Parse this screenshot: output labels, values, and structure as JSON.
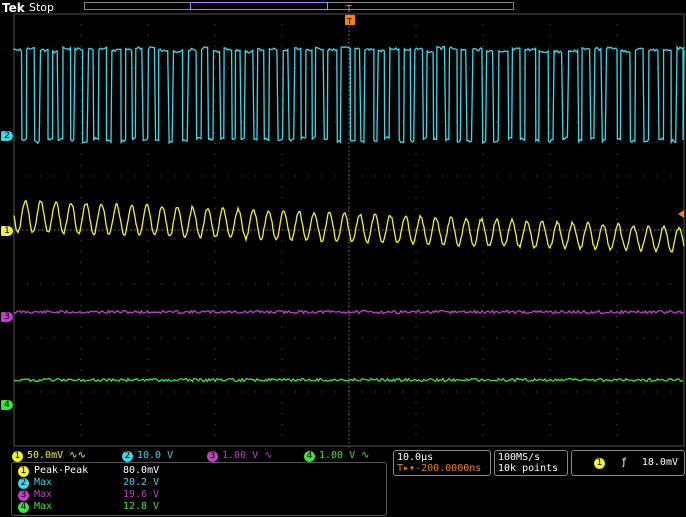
{
  "header": {
    "brand": "Tek",
    "state": "Stop"
  },
  "channels": [
    {
      "id": "1",
      "tag": "1",
      "color": "#f0f040",
      "scale": "50.0mV",
      "coupling_icon": "bandwidth-ac-icon"
    },
    {
      "id": "2",
      "tag": "2",
      "color": "#3fd6e8",
      "scale": "10.0 V",
      "coupling_icon": ""
    },
    {
      "id": "3",
      "tag": "3",
      "color": "#c040c8",
      "scale": "1.00 V",
      "coupling_icon": "bandwidth-icon"
    },
    {
      "id": "4",
      "tag": "4",
      "color": "#40e040",
      "scale": "1.00 V",
      "coupling_icon": "bandwidth-icon"
    }
  ],
  "horizontal": {
    "scale": "10.0µs",
    "trigger_position": "-200.0000ns"
  },
  "acquisition": {
    "sample_rate": "100MS/s",
    "record_length": "10k points"
  },
  "trigger": {
    "source": "1",
    "slope_icon": "rising-edge-icon",
    "level": "18.0mV"
  },
  "measurements": [
    {
      "channel": "1",
      "name": "Peak-Peak",
      "value": "80.0mV"
    },
    {
      "channel": "2",
      "name": "Max",
      "value": "20.2 V"
    },
    {
      "channel": "3",
      "name": "Max",
      "value": "19.6 V"
    },
    {
      "channel": "4",
      "name": "Max",
      "value": "12.8 V"
    }
  ]
}
